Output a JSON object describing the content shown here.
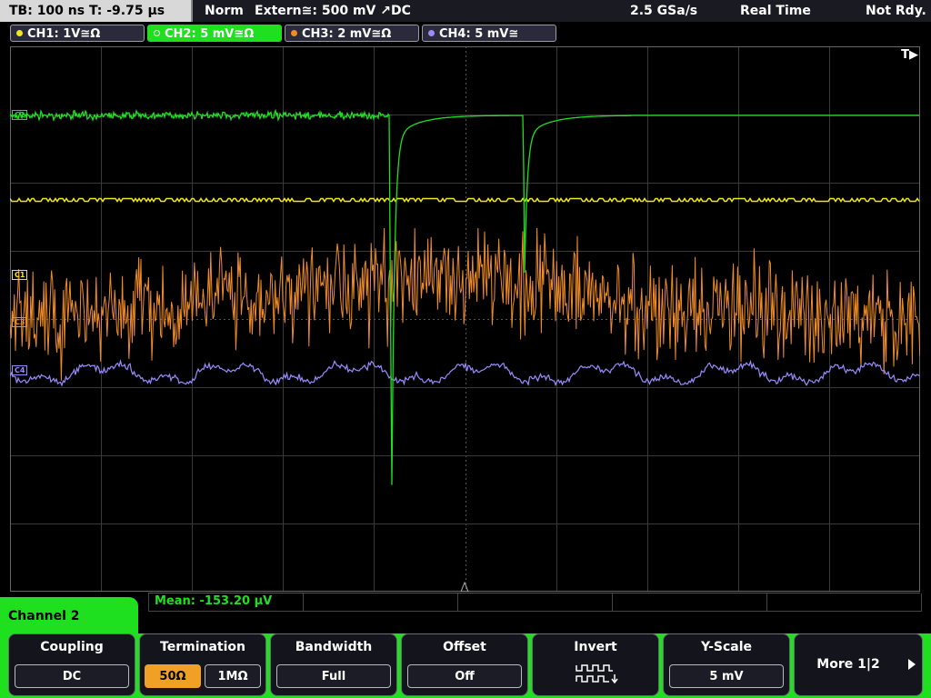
{
  "status": {
    "timebase": "TB: 100 ns   T: -9.75 µs",
    "trigger_mode": "Norm",
    "trigger_source": "Extern≅: 500 mV ↗DC",
    "sample_rate": "2.5 GSa/s",
    "acq_mode": "Real Time",
    "state": "Not Rdy."
  },
  "channels": [
    {
      "label": "CH1: 1V≅Ω",
      "color": "#f0e81c"
    },
    {
      "label": "CH2: 5 mV≅Ω",
      "color": "#1ee01e"
    },
    {
      "label": "CH3: 2 mV≅Ω",
      "color": "#f08c28"
    },
    {
      "label": "CH4: 5 mV≅",
      "color": "#9a8cff"
    }
  ],
  "plot": {
    "trigger_marker": "T▶",
    "ch_markers": [
      "C2",
      "C1",
      "C3",
      "C4"
    ]
  },
  "measurement": {
    "mean": "Mean: -153.20 µV"
  },
  "menu": {
    "channel_tab": "Channel 2",
    "coupling": {
      "title": "Coupling",
      "value": "DC"
    },
    "termination": {
      "title": "Termination",
      "opt1": "50Ω",
      "opt2": "1MΩ"
    },
    "bandwidth": {
      "title": "Bandwidth",
      "value": "Full"
    },
    "offset": {
      "title": "Offset",
      "value": "Off"
    },
    "invert": {
      "title": "Invert"
    },
    "yscale": {
      "title": "Y-Scale",
      "value": "5 mV"
    },
    "more": {
      "label": "More 1|2"
    }
  }
}
